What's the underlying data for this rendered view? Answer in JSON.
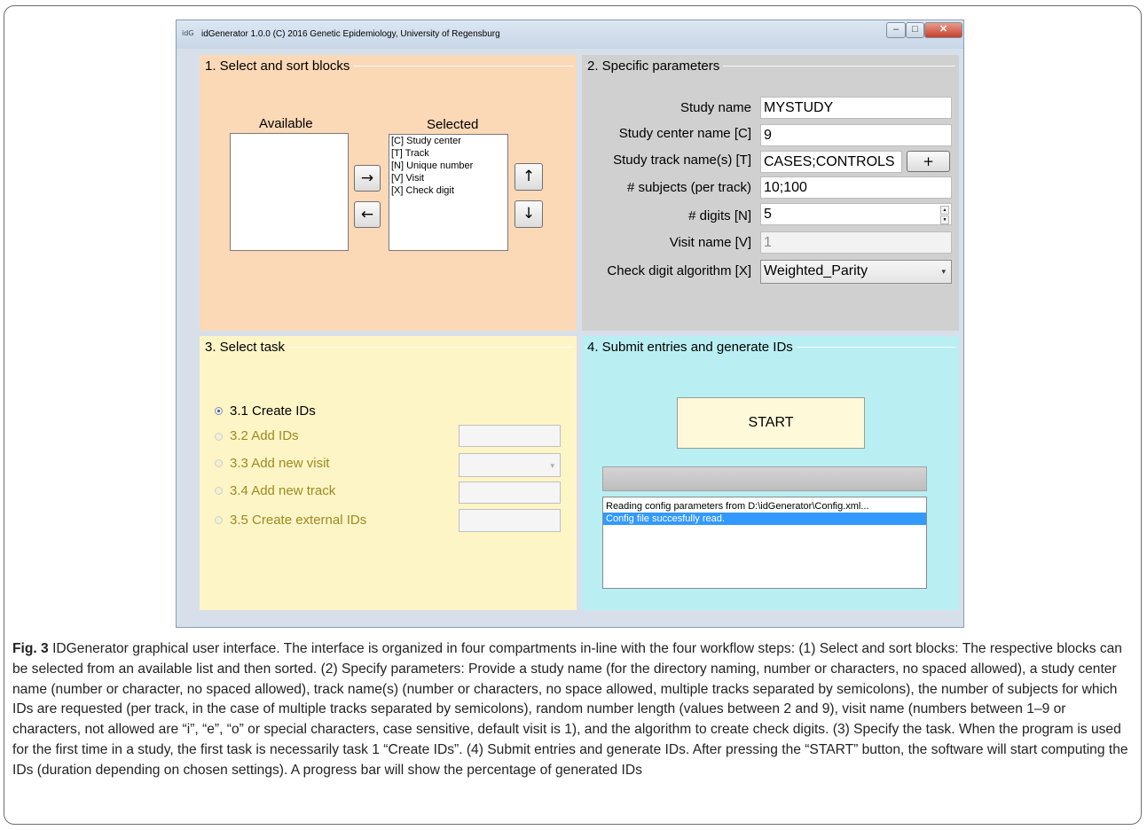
{
  "window": {
    "title": "idGenerator 1.0.0 (C) 2016 Genetic Epidemiology, University of Regensburg",
    "app_icon": "idG",
    "controls": {
      "minimize": "–",
      "maximize": "□",
      "close": "✕"
    }
  },
  "panel1": {
    "title": "1. Select and sort blocks",
    "available_label": "Available",
    "selected_label": "Selected",
    "available_items": [],
    "selected_items": [
      "[C] Study center",
      "[T] Track",
      "[N] Unique number",
      "[V] Visit",
      "[X] Check digit"
    ],
    "move_right": "→",
    "move_left": "←",
    "move_up": "↑",
    "move_down": "↓"
  },
  "panel2": {
    "title": "2. Specific parameters",
    "fields": [
      {
        "label": "Study name",
        "value": "MYSTUDY"
      },
      {
        "label": "Study center name [C]",
        "value": "9"
      },
      {
        "label": "Study track name(s) [T]",
        "value": "CASES;CONTROLS"
      },
      {
        "label": "# subjects (per track)",
        "value": "10;100"
      },
      {
        "label": "# digits [N]",
        "value": "5"
      },
      {
        "label": "Visit name [V]",
        "value": "1"
      },
      {
        "label": "Check digit algorithm [X]",
        "value": "Weighted_Parity"
      }
    ],
    "add_track_button": "+"
  },
  "panel3": {
    "title": "3. Select task",
    "options": [
      {
        "label": "3.1 Create IDs",
        "selected": true
      },
      {
        "label": "3.2 Add IDs",
        "selected": false
      },
      {
        "label": "3.3 Add new visit",
        "selected": false
      },
      {
        "label": "3.4 Add new track",
        "selected": false
      },
      {
        "label": "3.5 Create external IDs",
        "selected": false
      }
    ]
  },
  "panel4": {
    "title": "4. Submit entries and generate IDs",
    "start_button": "START",
    "progress_percent": 0,
    "log": [
      "Reading config parameters from D:\\idGenerator\\Config.xml...",
      "Config file succesfully read."
    ]
  },
  "caption": {
    "label": "Fig. 3",
    "text": " IDGenerator graphical user interface. The interface is organized in four compartments in-line with the four workflow steps: (1) Select and sort blocks: The respective blocks can be selected from an available list and then sorted. (2) Specify parameters: Provide a study name (for the directory naming, number or characters, no spaced allowed), a study center name (number or character, no spaced allowed), track name(s) (number or characters, no space allowed, multiple tracks separated by semicolons), the number of subjects for which IDs are requested (per track, in the case of multiple tracks separated by semicolons), random number length (values between 2 and 9), visit name (numbers between 1–9 or characters, not allowed are “i”, “e”, “o” or special characters, case sensitive, default visit is 1), and the algorithm to create check digits. (3) Specify the task. When the program is used for the first time in a study, the first task is necessarily task 1 “Create IDs”. (4) Submit entries and generate IDs. After pressing the “START” button, the software will start computing the IDs (duration depending on chosen settings). A progress bar will show the percentage of generated IDs"
  },
  "colors": {
    "panel1_bg": "#fbd8b6",
    "panel2_bg": "#d0d0d0",
    "panel3_bg": "#fdf5c6",
    "panel4_bg": "#b9eff2",
    "selection": "#3399ff"
  }
}
